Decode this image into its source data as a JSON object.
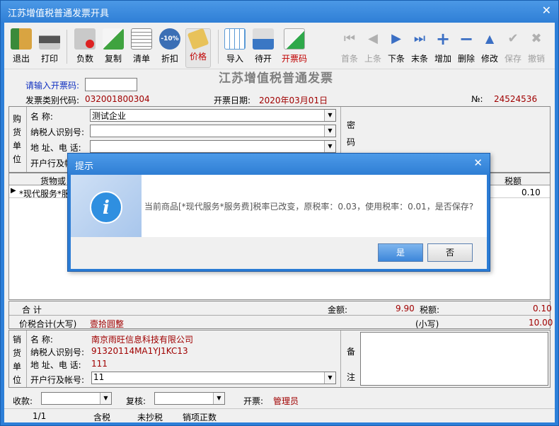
{
  "window": {
    "title": "江苏增值税普通发票开具",
    "close": "✕"
  },
  "toolbar": {
    "items": [
      {
        "label": "退出",
        "icon": "exit-icon"
      },
      {
        "label": "打印",
        "icon": "printer-icon"
      },
      {
        "label": "负数",
        "icon": "negative-icon"
      },
      {
        "label": "复制",
        "icon": "copy-icon"
      },
      {
        "label": "清单",
        "icon": "list-icon"
      },
      {
        "label": "折扣",
        "icon": "discount-icon",
        "badge": "-10%"
      },
      {
        "label": "价格",
        "icon": "price-tag-icon"
      },
      {
        "label": "导入",
        "icon": "import-icon"
      },
      {
        "label": "待开",
        "icon": "pending-icon"
      },
      {
        "label": "开票码",
        "icon": "invoice-code-icon"
      }
    ],
    "nav": [
      {
        "label": "首条",
        "glyph": "⏮"
      },
      {
        "label": "上条",
        "glyph": "◀"
      },
      {
        "label": "下条",
        "glyph": "▶"
      },
      {
        "label": "末条",
        "glyph": "⏭"
      },
      {
        "label": "增加",
        "glyph": "+"
      },
      {
        "label": "删除",
        "glyph": "−"
      },
      {
        "label": "修改",
        "glyph": "▲"
      },
      {
        "label": "保存",
        "glyph": "✔"
      },
      {
        "label": "撤销",
        "glyph": "✖"
      }
    ]
  },
  "invoice": {
    "title": "江苏增值税普通发票",
    "code_prompt": "请输入开票码:",
    "type_code_label": "发票类别代码:",
    "type_code": "032001800304",
    "date_label": "开票日期:",
    "date": "2020年03月01日",
    "no_label": "№:",
    "no": "24524536"
  },
  "buyer": {
    "side": [
      "购",
      "货",
      "单",
      "位"
    ],
    "name_label": "名      称:",
    "name": "测试企业",
    "tax_label": "纳税人识别号:",
    "addr_label": "地 址、电 话:",
    "bank_label": "开户行及帐",
    "secret": [
      "密",
      "码"
    ]
  },
  "grid": {
    "col_goods": "货物或",
    "col_tax": "税额",
    "row_goods": "*现代服务*服",
    "row_tax": "0.10"
  },
  "totals": {
    "sum_label": "合      计",
    "amount_label": "金额:",
    "amount": "9.90",
    "tax_label": "税额:",
    "tax": "0.10",
    "words_label": "价税合计(大写)",
    "words": "壹拾圆整",
    "small_label": "(小写)",
    "small": "10.00"
  },
  "seller": {
    "side": [
      "销",
      "货",
      "单",
      "位"
    ],
    "name_label": "名      称:",
    "name": "南京雨旺信息科技有限公司",
    "tax_label": "纳税人识别号:",
    "tax": "91320114MA1YJ1KC13",
    "addr_label": "地 址、电 话:",
    "addr": "111",
    "bank_label": "开户行及帐号:",
    "bank": "11",
    "remark": [
      "备",
      "注"
    ]
  },
  "footer": {
    "payee_label": "收款:",
    "checker_label": "复核:",
    "issuer_label": "开票:",
    "issuer": "管理员"
  },
  "status": {
    "page": "1/1",
    "tax_incl": "含税",
    "unsynced": "未抄税",
    "kind": "销项正数"
  },
  "dialog": {
    "title": "提示",
    "close": "✕",
    "icon": "info-icon",
    "message": "当前商品[*现代服务*服务费]税率已改变，原税率：0.03，使用税率：0.01，是否保存?",
    "yes": "是",
    "no": "否"
  }
}
